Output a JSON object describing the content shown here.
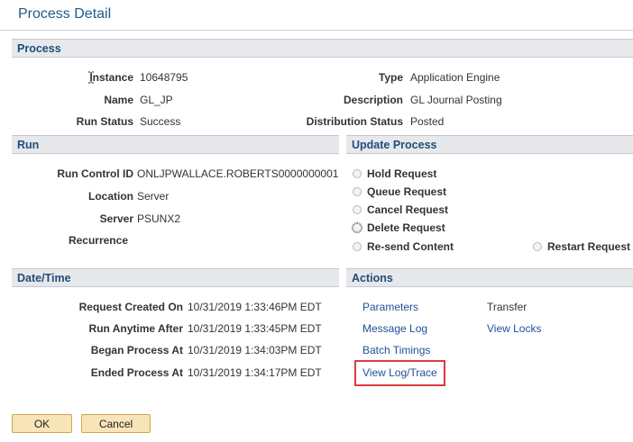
{
  "window": {
    "title": "Process Detail"
  },
  "process": {
    "header": "Process",
    "instance_label": "Instance",
    "instance_value": "10648795",
    "type_label": "Type",
    "type_value": "Application Engine",
    "name_label": "Name",
    "name_value": "GL_JP",
    "description_label": "Description",
    "description_value": "GL Journal Posting",
    "run_status_label": "Run Status",
    "run_status_value": "Success",
    "distribution_status_label": "Distribution Status",
    "distribution_status_value": "Posted"
  },
  "run": {
    "header": "Run",
    "run_control_label": "Run Control ID",
    "run_control_value": "ONLJPWALLACE.ROBERTS0000000001",
    "location_label": "Location",
    "location_value": "Server",
    "server_label": "Server",
    "server_value": "PSUNX2",
    "recurrence_label": "Recurrence",
    "recurrence_value": ""
  },
  "update_process": {
    "header": "Update Process",
    "options": [
      "Hold Request",
      "Queue Request",
      "Cancel Request",
      "Delete Request",
      "Re-send Content",
      "Restart Request"
    ]
  },
  "datetime": {
    "header": "Date/Time",
    "rows": [
      {
        "label": "Request Created On",
        "value": "10/31/2019  1:33:46PM EDT"
      },
      {
        "label": "Run Anytime After",
        "value": "10/31/2019  1:33:45PM EDT"
      },
      {
        "label": "Began Process At",
        "value": "10/31/2019  1:34:03PM EDT"
      },
      {
        "label": "Ended Process At",
        "value": "10/31/2019  1:34:17PM EDT"
      }
    ]
  },
  "actions": {
    "header": "Actions",
    "parameters": "Parameters",
    "transfer": "Transfer",
    "message_log": "Message Log",
    "view_locks": "View Locks",
    "batch_timings": "Batch Timings",
    "view_log_trace": "View Log/Trace"
  },
  "buttons": {
    "ok": "OK",
    "cancel": "Cancel"
  },
  "colors": {
    "header_bg": "#e6e8eb",
    "header_text": "#1f4e79",
    "link": "#1f4f99",
    "highlight": "#e03a3e",
    "button_bg": "#f7e5b8"
  }
}
